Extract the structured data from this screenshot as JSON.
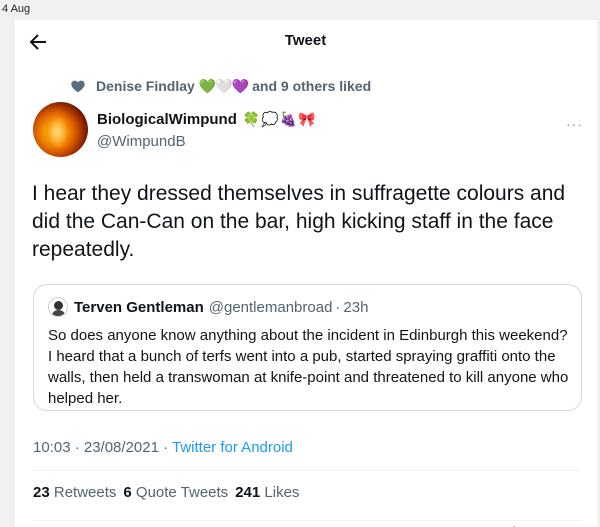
{
  "date_label": "4 Aug",
  "header": {
    "title": "Tweet"
  },
  "liked_by": {
    "name": "Denise Findlay",
    "name_emoji": "💚🤍💜",
    "rest": "and 9 others liked"
  },
  "author": {
    "name": "BiologicalWimpund",
    "name_emoji": "🍀💭🍇🎀",
    "handle": "@WimpundB"
  },
  "more_icon": "···",
  "tweet_text": "I hear they dressed themselves in suffragette colours and did the Can-Can on the bar, high kicking staff in the face repeatedly.",
  "quote": {
    "name": "Terven Gentleman",
    "handle": "@gentlemanbroad",
    "dot": "·",
    "time": "23h",
    "text": "So does anyone know anything about the incident in Edinburgh this weekend? I heard that a bunch of terfs went into a pub, started spraying graffiti onto the walls, then held a transwoman at knife-point and threatened to kill anyone who helped her."
  },
  "meta": {
    "timestamp": "10:03 · 23/08/2021 · ",
    "source": "Twitter for Android"
  },
  "stats": {
    "retweets_count": "23",
    "retweets_label": "Retweets",
    "quotes_count": "6",
    "quotes_label": "Quote Tweets",
    "likes_count": "241",
    "likes_label": "Likes"
  },
  "colors": {
    "accent": "#1d9bf0",
    "secondary_text": "#536471",
    "primary_text": "#0f1419"
  },
  "icons": [
    "back-arrow-icon",
    "heart-icon",
    "more-options-icon",
    "reply-icon",
    "share-icon"
  ]
}
